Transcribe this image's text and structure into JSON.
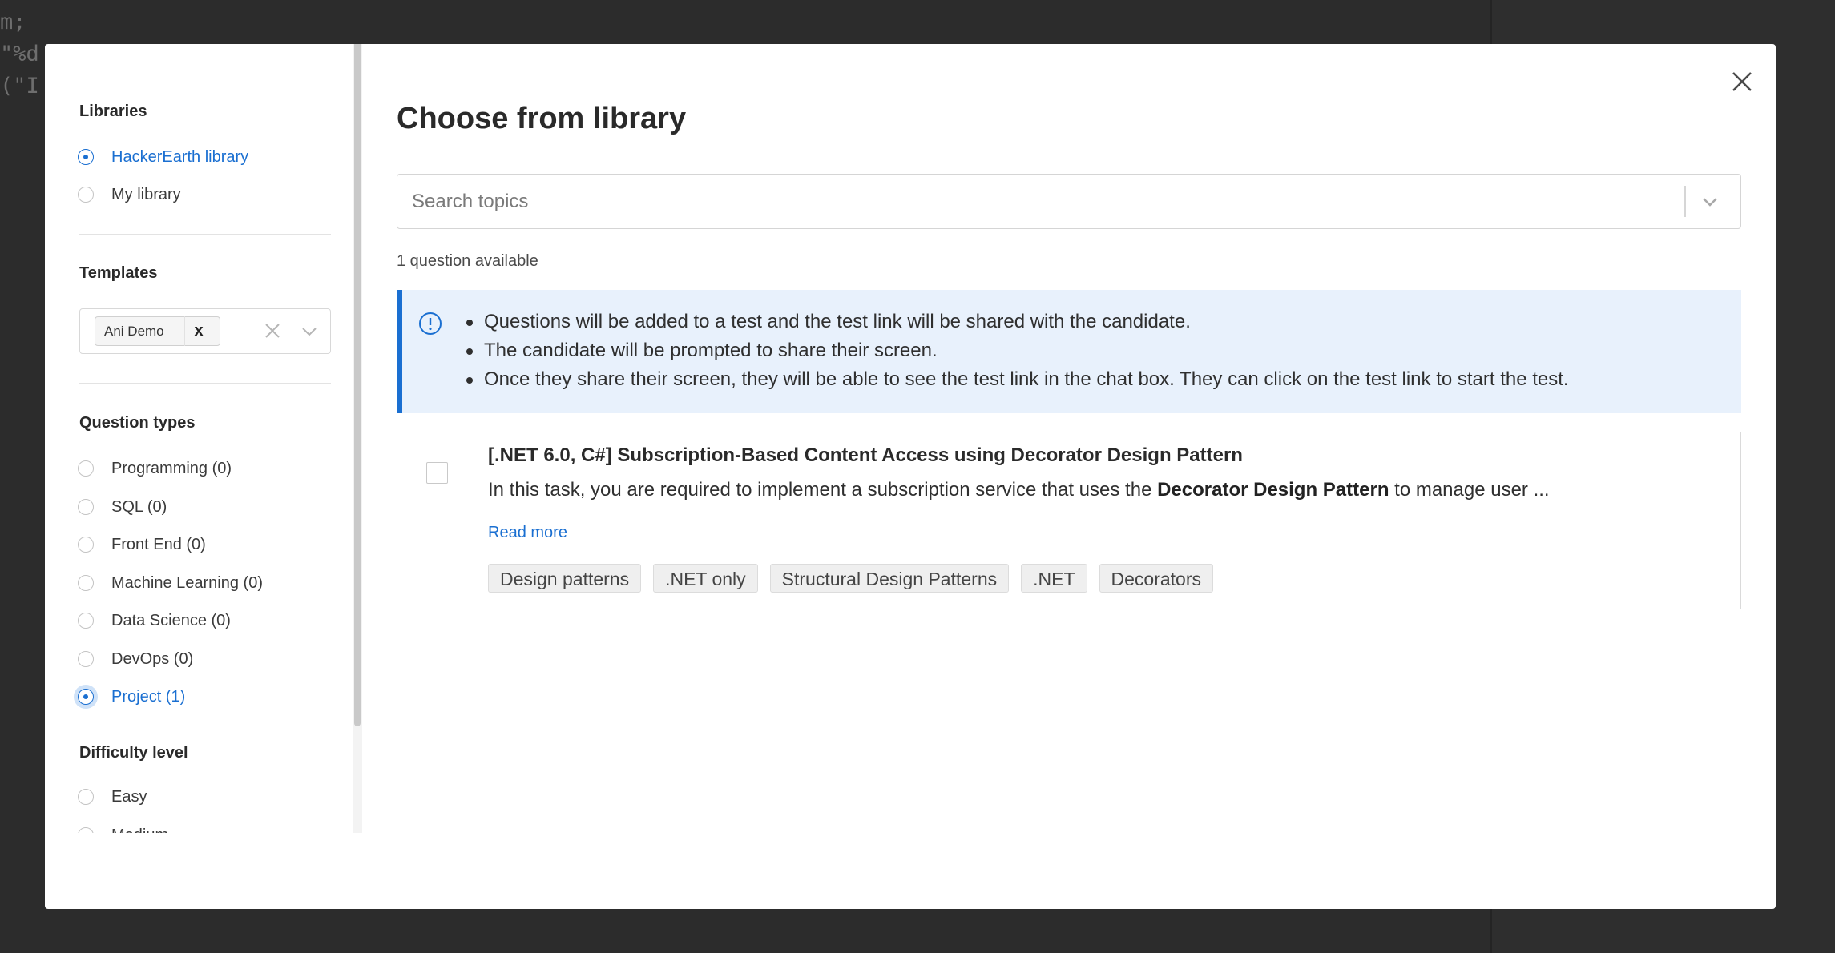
{
  "background": {
    "code_lines": [
      "m;",
      "\"%d",
      "(\"I"
    ]
  },
  "sidebar": {
    "libraries": {
      "title": "Libraries",
      "options": [
        {
          "label": "HackerEarth library",
          "selected": true
        },
        {
          "label": "My library",
          "selected": false
        }
      ]
    },
    "templates": {
      "title": "Templates",
      "selected_tag": "Ani Demo",
      "tag_remove": "x"
    },
    "question_types": {
      "title": "Question types",
      "options": [
        {
          "label": "Programming (0)",
          "selected": false
        },
        {
          "label": "SQL (0)",
          "selected": false
        },
        {
          "label": "Front End (0)",
          "selected": false
        },
        {
          "label": "Machine Learning (0)",
          "selected": false
        },
        {
          "label": "Data Science (0)",
          "selected": false
        },
        {
          "label": "DevOps (0)",
          "selected": false
        },
        {
          "label": "Project (1)",
          "selected": true
        }
      ]
    },
    "difficulty": {
      "title": "Difficulty level",
      "options": [
        {
          "label": "Easy",
          "selected": false
        },
        {
          "label": "Medium",
          "selected": false
        }
      ]
    }
  },
  "main": {
    "title": "Choose from library",
    "search": {
      "placeholder": "Search topics",
      "value": ""
    },
    "count_text": "1 question available",
    "info": {
      "items": [
        "Questions will be added to a test and the test link will be shared with the candidate.",
        "The candidate will be prompted to share their screen.",
        "Once they share their screen, they will be able to see the test link in the chat box. They can click on the test link to start the test."
      ]
    },
    "question": {
      "title": "[.NET 6.0, C#] Subscription-Based Content Access using Decorator Design Pattern",
      "desc_before": "In this task, you are required to implement a subscription service that uses the ",
      "desc_bold": "Decorator Design Pattern",
      "desc_after": " to manage user ...",
      "read_more": "Read more",
      "tags": [
        "Design patterns",
        ".NET only",
        "Structural Design Patterns",
        ".NET",
        "Decorators"
      ],
      "checked": false
    }
  },
  "colors": {
    "accent": "#1a6fd1",
    "info_bg": "#e8f1fc",
    "backdrop": "#2c2c2c"
  }
}
